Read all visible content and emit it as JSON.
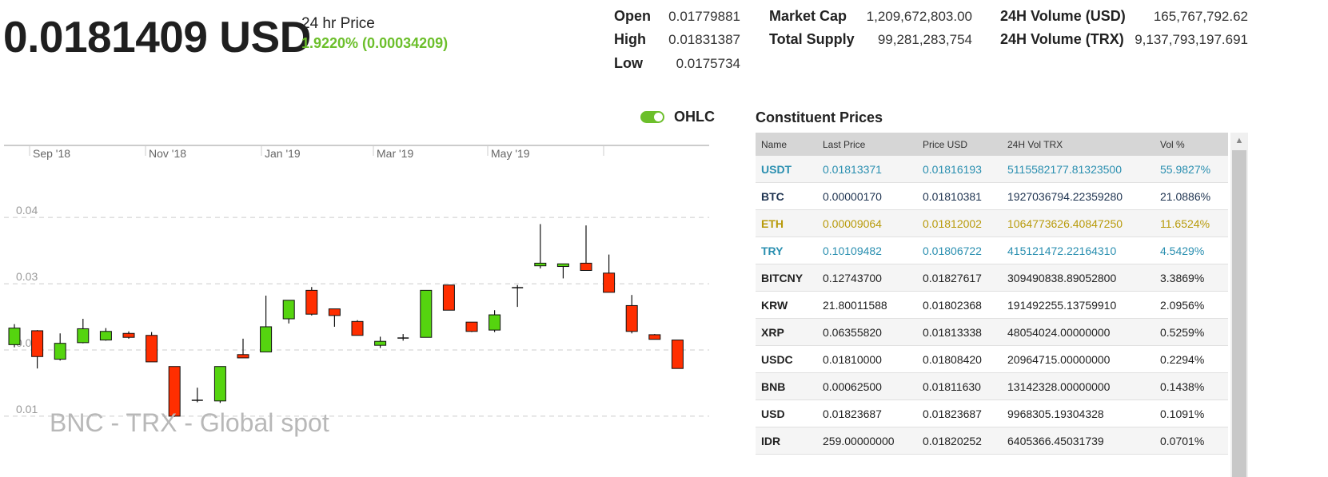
{
  "header": {
    "price": "0.0181409 USD",
    "price_label": "24 hr Price",
    "change": "1.9220% (0.00034209)",
    "change_color": "#6cbf2b"
  },
  "stats": {
    "open_label": "Open",
    "open_value": "0.01779881",
    "high_label": "High",
    "high_value": "0.01831387",
    "low_label": "Low",
    "low_value": "0.0175734",
    "mcap_label": "Market Cap",
    "mcap_value": "1,209,672,803.00",
    "supply_label": "Total Supply",
    "supply_value": "99,281,283,754",
    "volusd_label": "24H Volume (USD)",
    "volusd_value": "165,767,792.62",
    "voltrx_label": "24H Volume (TRX)",
    "voltrx_value": "9,137,793,197.691"
  },
  "toggle": {
    "label": "OHLC",
    "on": true
  },
  "chart_data": {
    "type": "candlestick",
    "watermark": "BNC - TRX - Global spot",
    "x_tick_labels": [
      "Sep '18",
      "Nov '18",
      "Jan '19",
      "Mar '19",
      "May '19"
    ],
    "y_tick_labels": [
      "0.04",
      "0.03",
      "0.02",
      "0.01"
    ],
    "y_ticks": [
      0.04,
      0.03,
      0.02,
      0.01
    ],
    "ylim": [
      0.0089,
      0.0475
    ],
    "grid": true,
    "up_color": "#55d40f",
    "down_color": "#ff2e00",
    "candles": [
      {
        "o": 0.0208,
        "h": 0.0239,
        "l": 0.0204,
        "c": 0.0233
      },
      {
        "o": 0.0229,
        "h": 0.023,
        "l": 0.0172,
        "c": 0.019
      },
      {
        "o": 0.0186,
        "h": 0.0225,
        "l": 0.0184,
        "c": 0.021
      },
      {
        "o": 0.0211,
        "h": 0.0247,
        "l": 0.021,
        "c": 0.0232
      },
      {
        "o": 0.0215,
        "h": 0.0233,
        "l": 0.0214,
        "c": 0.0228
      },
      {
        "o": 0.0225,
        "h": 0.0228,
        "l": 0.0217,
        "c": 0.0219
      },
      {
        "o": 0.0222,
        "h": 0.0227,
        "l": 0.0182,
        "c": 0.0182
      },
      {
        "o": 0.0175,
        "h": 0.0175,
        "l": 0.0099,
        "c": 0.01
      },
      {
        "o": 0.0124,
        "h": 0.0143,
        "l": 0.0121,
        "c": 0.0124
      },
      {
        "o": 0.0123,
        "h": 0.0175,
        "l": 0.012,
        "c": 0.0175
      },
      {
        "o": 0.0193,
        "h": 0.0217,
        "l": 0.0188,
        "c": 0.0188
      },
      {
        "o": 0.0197,
        "h": 0.0282,
        "l": 0.0197,
        "c": 0.0235
      },
      {
        "o": 0.0247,
        "h": 0.0275,
        "l": 0.024,
        "c": 0.0275
      },
      {
        "o": 0.029,
        "h": 0.0295,
        "l": 0.0252,
        "c": 0.0254
      },
      {
        "o": 0.0262,
        "h": 0.0262,
        "l": 0.0235,
        "c": 0.0252
      },
      {
        "o": 0.0243,
        "h": 0.0245,
        "l": 0.0222,
        "c": 0.0222
      },
      {
        "o": 0.0207,
        "h": 0.022,
        "l": 0.0203,
        "c": 0.0213
      },
      {
        "o": 0.0217,
        "h": 0.0224,
        "l": 0.0214,
        "c": 0.0218
      },
      {
        "o": 0.0219,
        "h": 0.029,
        "l": 0.0219,
        "c": 0.029
      },
      {
        "o": 0.0298,
        "h": 0.0298,
        "l": 0.026,
        "c": 0.026
      },
      {
        "o": 0.0242,
        "h": 0.0242,
        "l": 0.0227,
        "c": 0.0228
      },
      {
        "o": 0.023,
        "h": 0.026,
        "l": 0.0227,
        "c": 0.0253
      },
      {
        "o": 0.0294,
        "h": 0.0298,
        "l": 0.0265,
        "c": 0.0294
      },
      {
        "o": 0.0327,
        "h": 0.039,
        "l": 0.0323,
        "c": 0.0331
      },
      {
        "o": 0.0326,
        "h": 0.0329,
        "l": 0.0308,
        "c": 0.033
      },
      {
        "o": 0.0331,
        "h": 0.0388,
        "l": 0.032,
        "c": 0.032
      },
      {
        "o": 0.0316,
        "h": 0.0344,
        "l": 0.0287,
        "c": 0.0287
      },
      {
        "o": 0.0267,
        "h": 0.0283,
        "l": 0.0225,
        "c": 0.0228
      },
      {
        "o": 0.0223,
        "h": 0.0224,
        "l": 0.0216,
        "c": 0.0216
      },
      {
        "o": 0.0215,
        "h": 0.0215,
        "l": 0.0172,
        "c": 0.0172
      }
    ]
  },
  "constituents": {
    "title": "Constituent Prices",
    "headers": [
      "Name",
      "Last Price",
      "Price USD",
      "24H Vol TRX",
      "Vol %"
    ],
    "rows": [
      {
        "name": "USDT",
        "last": "0.01813371",
        "usd": "0.01816193",
        "vol": "5115582177.81323500",
        "pct": "55.9827%",
        "color": "#2a8fb0"
      },
      {
        "name": "BTC",
        "last": "0.00000170",
        "usd": "0.01810381",
        "vol": "1927036794.22359280",
        "pct": "21.0886%",
        "color": "#1e3350"
      },
      {
        "name": "ETH",
        "last": "0.00009064",
        "usd": "0.01812002",
        "vol": "1064773626.40847250",
        "pct": "11.6524%",
        "color": "#b89a0a"
      },
      {
        "name": "TRY",
        "last": "0.10109482",
        "usd": "0.01806722",
        "vol": "415121472.22164310",
        "pct": "4.5429%",
        "color": "#2a8fb0"
      },
      {
        "name": "BITCNY",
        "last": "0.12743700",
        "usd": "0.01827617",
        "vol": "309490838.89052800",
        "pct": "3.3869%",
        "color": "#222222"
      },
      {
        "name": "KRW",
        "last": "21.80011588",
        "usd": "0.01802368",
        "vol": "191492255.13759910",
        "pct": "2.0956%",
        "color": "#222222"
      },
      {
        "name": "XRP",
        "last": "0.06355820",
        "usd": "0.01813338",
        "vol": "48054024.00000000",
        "pct": "0.5259%",
        "color": "#222222"
      },
      {
        "name": "USDC",
        "last": "0.01810000",
        "usd": "0.01808420",
        "vol": "20964715.00000000",
        "pct": "0.2294%",
        "color": "#222222"
      },
      {
        "name": "BNB",
        "last": "0.00062500",
        "usd": "0.01811630",
        "vol": "13142328.00000000",
        "pct": "0.1438%",
        "color": "#222222"
      },
      {
        "name": "USD",
        "last": "0.01823687",
        "usd": "0.01823687",
        "vol": "9968305.19304328",
        "pct": "0.1091%",
        "color": "#222222"
      },
      {
        "name": "IDR",
        "last": "259.00000000",
        "usd": "0.01820252",
        "vol": "6405366.45031739",
        "pct": "0.0701%",
        "color": "#222222"
      }
    ]
  }
}
